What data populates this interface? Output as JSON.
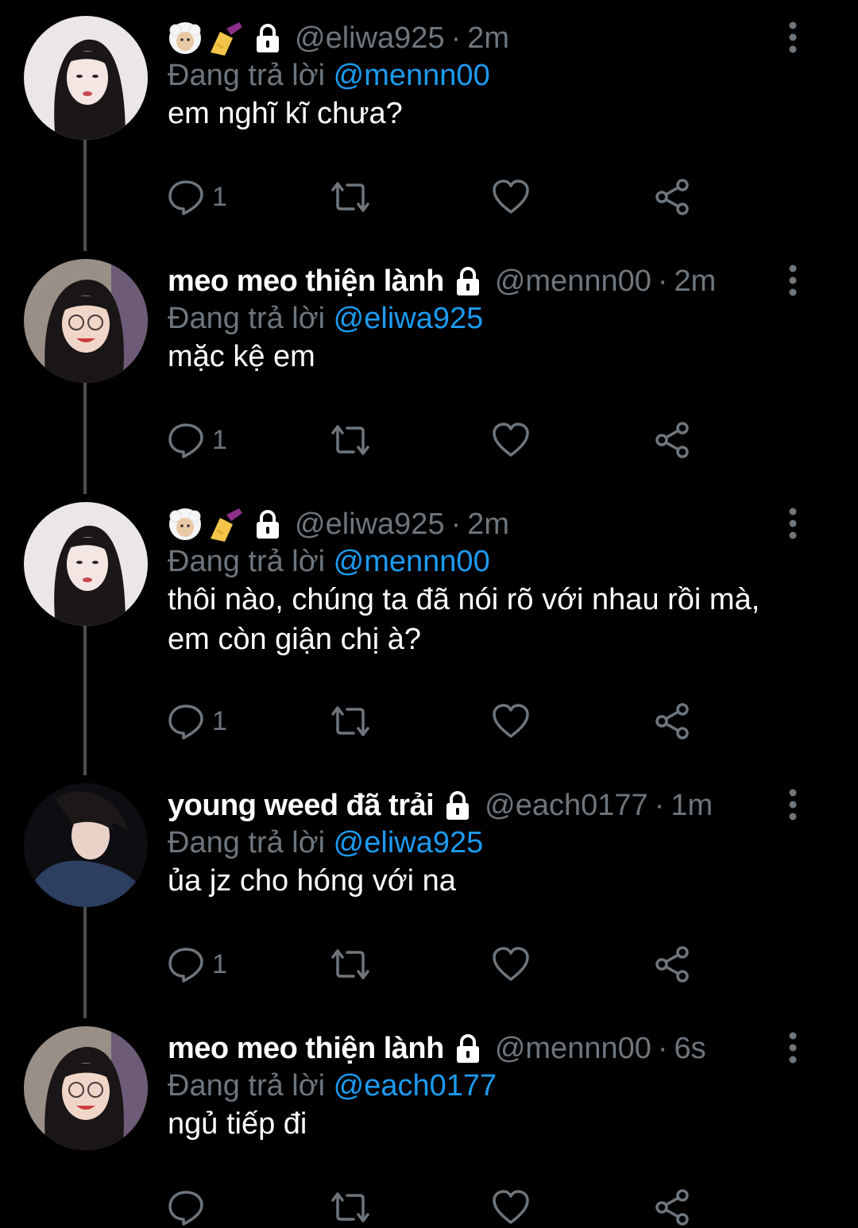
{
  "thread": {
    "tweets": [
      {
        "display_name": "",
        "name_emojis": [
          "sheep-face",
          "nail-polish"
        ],
        "handle": "@eliwa925",
        "time": "2m",
        "replying_prefix": "Đang trả lời",
        "replying_to": "@mennn00",
        "text": "em nghĩ kĩ chưa?",
        "reply_count": "1",
        "avatar": "eliwa-avatar"
      },
      {
        "display_name": "meo meo thiện lành",
        "name_emojis": [],
        "handle": "@mennn00",
        "time": "2m",
        "replying_prefix": "Đang trả lời",
        "replying_to": "@eliwa925",
        "text": "mặc kệ em",
        "reply_count": "1",
        "avatar": "mennn-avatar"
      },
      {
        "display_name": "",
        "name_emojis": [
          "sheep-face",
          "nail-polish"
        ],
        "handle": "@eliwa925",
        "time": "2m",
        "replying_prefix": "Đang trả lời",
        "replying_to": "@mennn00",
        "text": "thôi nào, chúng ta đã nói rõ với nhau rồi mà, em còn giận chị à?",
        "reply_count": "1",
        "avatar": "eliwa-avatar"
      },
      {
        "display_name": "young weed đã trải",
        "name_emojis": [],
        "handle": "@each0177",
        "time": "1m",
        "replying_prefix": "Đang trả lời",
        "replying_to": "@eliwa925",
        "text": "ủa jz cho hóng với na",
        "reply_count": "1",
        "avatar": "each-avatar"
      },
      {
        "display_name": "meo meo thiện lành",
        "name_emojis": [],
        "handle": "@mennn00",
        "time": "6s",
        "replying_prefix": "Đang trả lời",
        "replying_to": "@each0177",
        "text": "ngủ tiếp đi",
        "reply_count": "",
        "avatar": "mennn-avatar"
      }
    ]
  },
  "icons": {
    "lock": "lock-icon",
    "more": "more-vertical-icon",
    "reply": "reply-icon",
    "retweet": "retweet-icon",
    "like": "heart-icon",
    "share": "share-icon"
  },
  "colors": {
    "background": "#000000",
    "text": "#ffffff",
    "muted": "#6e767d",
    "link": "#1d9bf0",
    "thread_line": "#4a4f54"
  }
}
